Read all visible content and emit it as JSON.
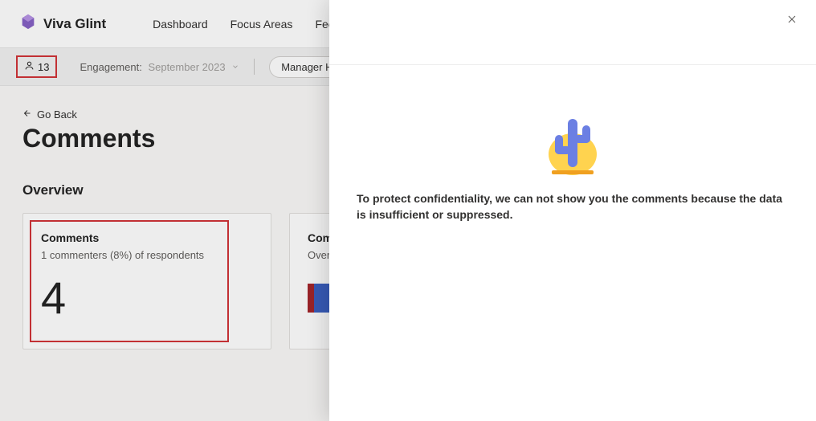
{
  "brand": "Viva Glint",
  "nav": {
    "dashboard": "Dashboard",
    "focus_areas": "Focus Areas",
    "feed": "Feed"
  },
  "filters": {
    "respondents_count": "13",
    "engagement_label": "Engagement:",
    "engagement_period": "September 2023",
    "manager_hierarchy_label": "Manager Hierarchy:"
  },
  "page": {
    "goback": "Go Back",
    "title": "Comments",
    "overview_heading": "Overview"
  },
  "cards": {
    "comments": {
      "title": "Comments",
      "subtitle": "1 commenters (8%) of respondents",
      "big_number": "4"
    },
    "sentiment": {
      "title": "Comm",
      "subtitle": "Overal",
      "segments": [
        {
          "color": "#a4262c",
          "pct": 2
        },
        {
          "color": "#3b5fc0",
          "pct": 98
        }
      ]
    }
  },
  "panel": {
    "message": "To protect confidentiality, we can not show you the comments because the data is insufficient or suppressed."
  },
  "colors": {
    "accent_red": "#d13438"
  }
}
